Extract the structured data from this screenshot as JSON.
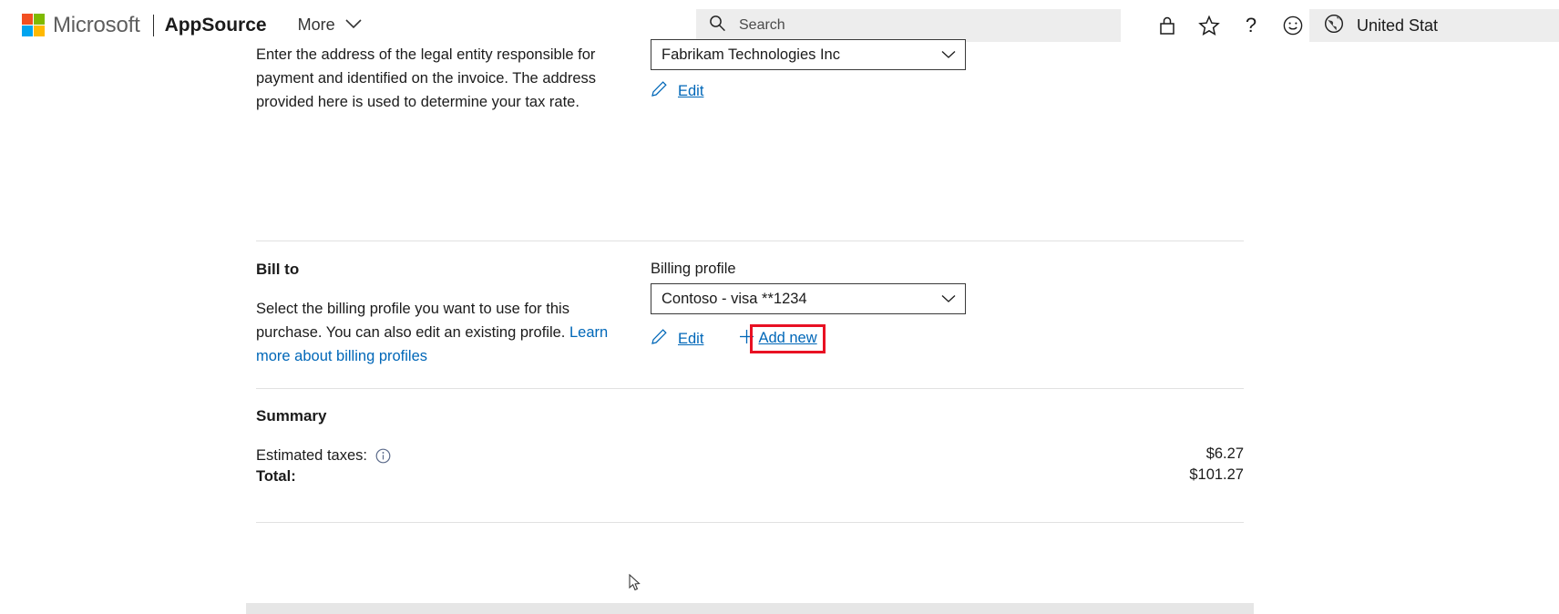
{
  "header": {
    "brand": "Microsoft",
    "app_name": "AppSource",
    "more_label": "More",
    "search_placeholder": "Search",
    "region_label": "United Stat",
    "icons": {
      "logo": "microsoft-logo",
      "chevron": "chevron-down-icon",
      "search": "search-icon",
      "privacy": "lock-icon",
      "favorites": "star-icon",
      "help": "?",
      "feedback": "smiley-icon",
      "globe": "globe-icon"
    },
    "colors": {
      "logo_red": "#f25022",
      "logo_green": "#7fba00",
      "logo_blue": "#00a4ef",
      "logo_yellow": "#ffb900",
      "search_bg": "#ededed"
    }
  },
  "sell_to": {
    "description": "Enter the address of the legal entity responsible for payment and identified on the invoice. The address provided here is used to determine your tax rate.",
    "combo_value": "Fabrikam Technologies Inc",
    "edit_label": "Edit"
  },
  "bill_to": {
    "title": "Bill to",
    "description_before_link": "Select the billing profile you want to use for this purchase. You can also edit an existing profile. ",
    "link_label": "Learn more about billing profiles",
    "field_label": "Billing profile",
    "combo_value": "Contoso - visa **1234",
    "edit_label": "Edit",
    "add_new_label": "Add new",
    "highlight_color": "#e81123",
    "link_color": "#0067b8"
  },
  "summary": {
    "title": "Summary",
    "rows": [
      {
        "label": "Estimated taxes:",
        "amount": "$6.27",
        "bold": false,
        "has_info_icon": true
      },
      {
        "label": "Total:",
        "amount": "$101.27",
        "bold": true,
        "has_info_icon": false
      }
    ]
  }
}
